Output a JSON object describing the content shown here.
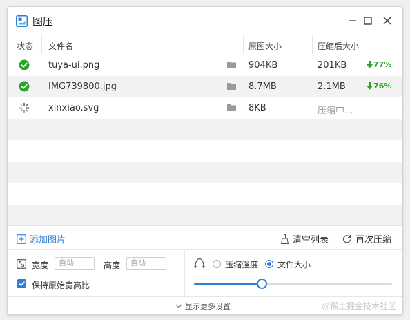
{
  "window": {
    "title": "图压",
    "controls": {
      "minimize": "minimize-icon",
      "maximize": "maximize-icon",
      "close": "close-icon"
    }
  },
  "table": {
    "headers": {
      "status": "状态",
      "filename": "文件名",
      "original_size": "原图大小",
      "compressed_size": "压缩后大小"
    },
    "rows": [
      {
        "status": "done",
        "filename": "tuya-ui.png",
        "original_size": "904KB",
        "compressed_size": "201KB",
        "saving": "77%"
      },
      {
        "status": "done",
        "filename": "IMG739800.jpg",
        "original_size": "8.7MB",
        "compressed_size": "2.1MB",
        "saving": "76%"
      },
      {
        "status": "loading",
        "filename": "xinxiao.svg",
        "original_size": "8KB",
        "compressed_size": "压缩中...",
        "saving": ""
      }
    ]
  },
  "actions": {
    "add_image": "添加图片",
    "clear_list": "清空列表",
    "recompress": "再次压缩"
  },
  "settings": {
    "width_label": "宽度",
    "width_placeholder": "自动",
    "height_label": "高度",
    "height_placeholder": "自动",
    "keep_ratio_label": "保持原始宽高比",
    "keep_ratio_checked": true,
    "mode_options": [
      "压缩强度",
      "文件大小"
    ],
    "mode_selected": "文件大小",
    "slider_value": 0.34
  },
  "footer": {
    "more_settings": "显示更多设置"
  },
  "watermark": "@稀土掘金技术社区",
  "colors": {
    "accent": "#2e7ed6",
    "success": "#2aa52a"
  }
}
